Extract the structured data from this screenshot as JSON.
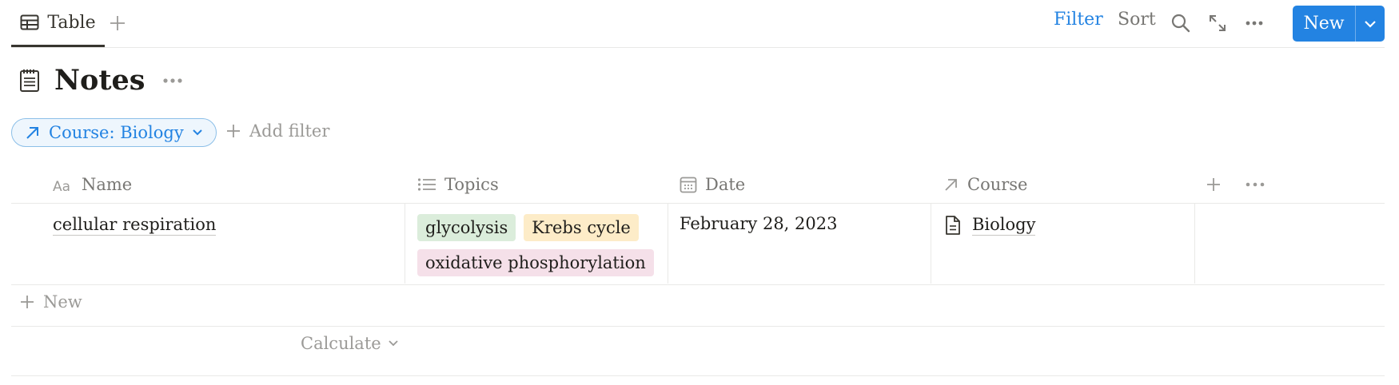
{
  "toolbar": {
    "view_tab_label": "Table",
    "filter_label": "Filter",
    "sort_label": "Sort",
    "new_label": "New",
    "icons": [
      "table-icon",
      "plus-icon",
      "search-icon",
      "expand-icon",
      "more-icon",
      "chevron-down-icon"
    ],
    "accent_color": "#2383e2"
  },
  "page": {
    "title": "Notes",
    "icon": "document-icon"
  },
  "filters": {
    "active_chip_label": "Course: Biology",
    "add_filter_label": "Add filter"
  },
  "table": {
    "columns": [
      {
        "label": "Name",
        "icon": "text-type-icon"
      },
      {
        "label": "Topics",
        "icon": "list-icon"
      },
      {
        "label": "Date",
        "icon": "calendar-icon"
      },
      {
        "label": "Course",
        "icon": "relation-arrow-icon"
      }
    ],
    "rows": [
      {
        "name": "cellular respiration",
        "topics": [
          {
            "label": "glycolysis",
            "color": "#dbeddb"
          },
          {
            "label": "Krebs cycle",
            "color": "#fdecc8"
          },
          {
            "label": "oxidative phosphorylation",
            "color": "#f5e0e9"
          }
        ],
        "date": "February 28, 2023",
        "course": "Biology"
      }
    ],
    "new_row_label": "New",
    "calculate_label": "Calculate"
  }
}
